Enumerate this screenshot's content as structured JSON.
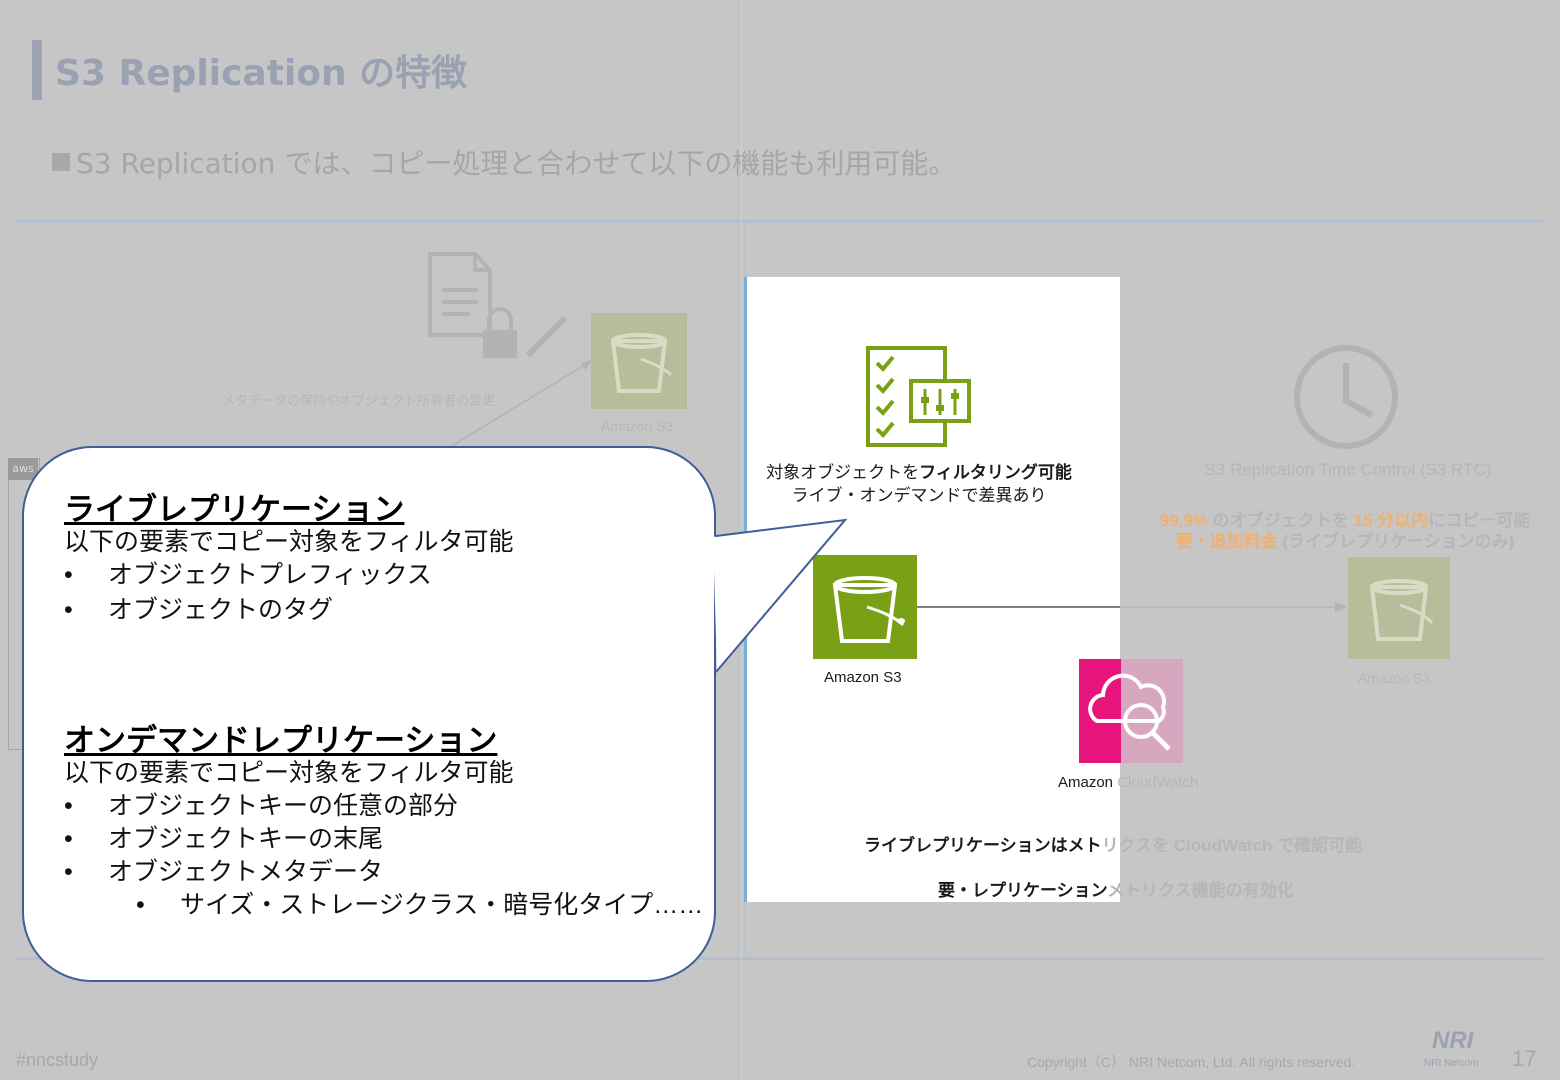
{
  "title": "S3 Replication の特徴",
  "subtitle": "S3 Replication では、コピー処理と合わせて以下の機能も利用可能。",
  "left_diagram": {
    "metadata_caption": "メタデータの保持やオブジェクト所有者の変更",
    "s3_label": "Amazon S3",
    "aws_badge": "aws"
  },
  "panel": {
    "filter_line1_a": "対象オブジェクトを",
    "filter_line1_b": "フィルタリング可能",
    "filter_line2": "ライブ・オンデマンドで差異あり",
    "s3_label": "Amazon S3",
    "cloudwatch_label_a": "Amazon ",
    "cloudwatch_label_b": "CloudWatch",
    "metrics_line_a": "ライブレプリケーションはメト",
    "metrics_line_b": "リクスを CloudWatch で確認可能",
    "enable_line_a": "要・レプリケーション",
    "enable_line_b": "メトリクス機能の有効化"
  },
  "rtc": {
    "title": "S3 Replication Time Control (S3 RTC)",
    "pct": "99.9%",
    "line1_mid": " のオブジェクトを ",
    "minutes": "15 分以内",
    "line1_end": "にコピー可能",
    "fee": "要・追加料金",
    "line2_end": " (ライブレプリケーションのみ)",
    "s3_label": "Amazon S3"
  },
  "bubble": {
    "live_heading": "ライブレプリケーション",
    "live_desc": "以下の要素でコピー対象をフィルタ可能",
    "live_items": [
      "オブジェクトプレフィックス",
      "オブジェクトのタグ"
    ],
    "ondemand_heading": "オンデマンドレプリケーション",
    "ondemand_desc": "以下の要素でコピー対象をフィルタ可能",
    "ondemand_items": [
      "オブジェクトキーの任意の部分",
      "オブジェクトキーの末尾",
      "オブジェクトメタデータ"
    ],
    "ondemand_subitem": "サイズ・ストレージクラス・暗号化タイプ……"
  },
  "footer": {
    "hashtag": "#nncstudy",
    "copyright": "Copyright（C） NRI Netcom, Ltd. All rights reserved.",
    "logo": "NRI",
    "logo_sub": "NRI Netcom",
    "page": "17"
  },
  "colors": {
    "s3_green": "#7aa116",
    "cloudwatch_pink": "#e7157b",
    "bubble_border": "#3f5e98",
    "highlight_orange": "#f0b070"
  }
}
